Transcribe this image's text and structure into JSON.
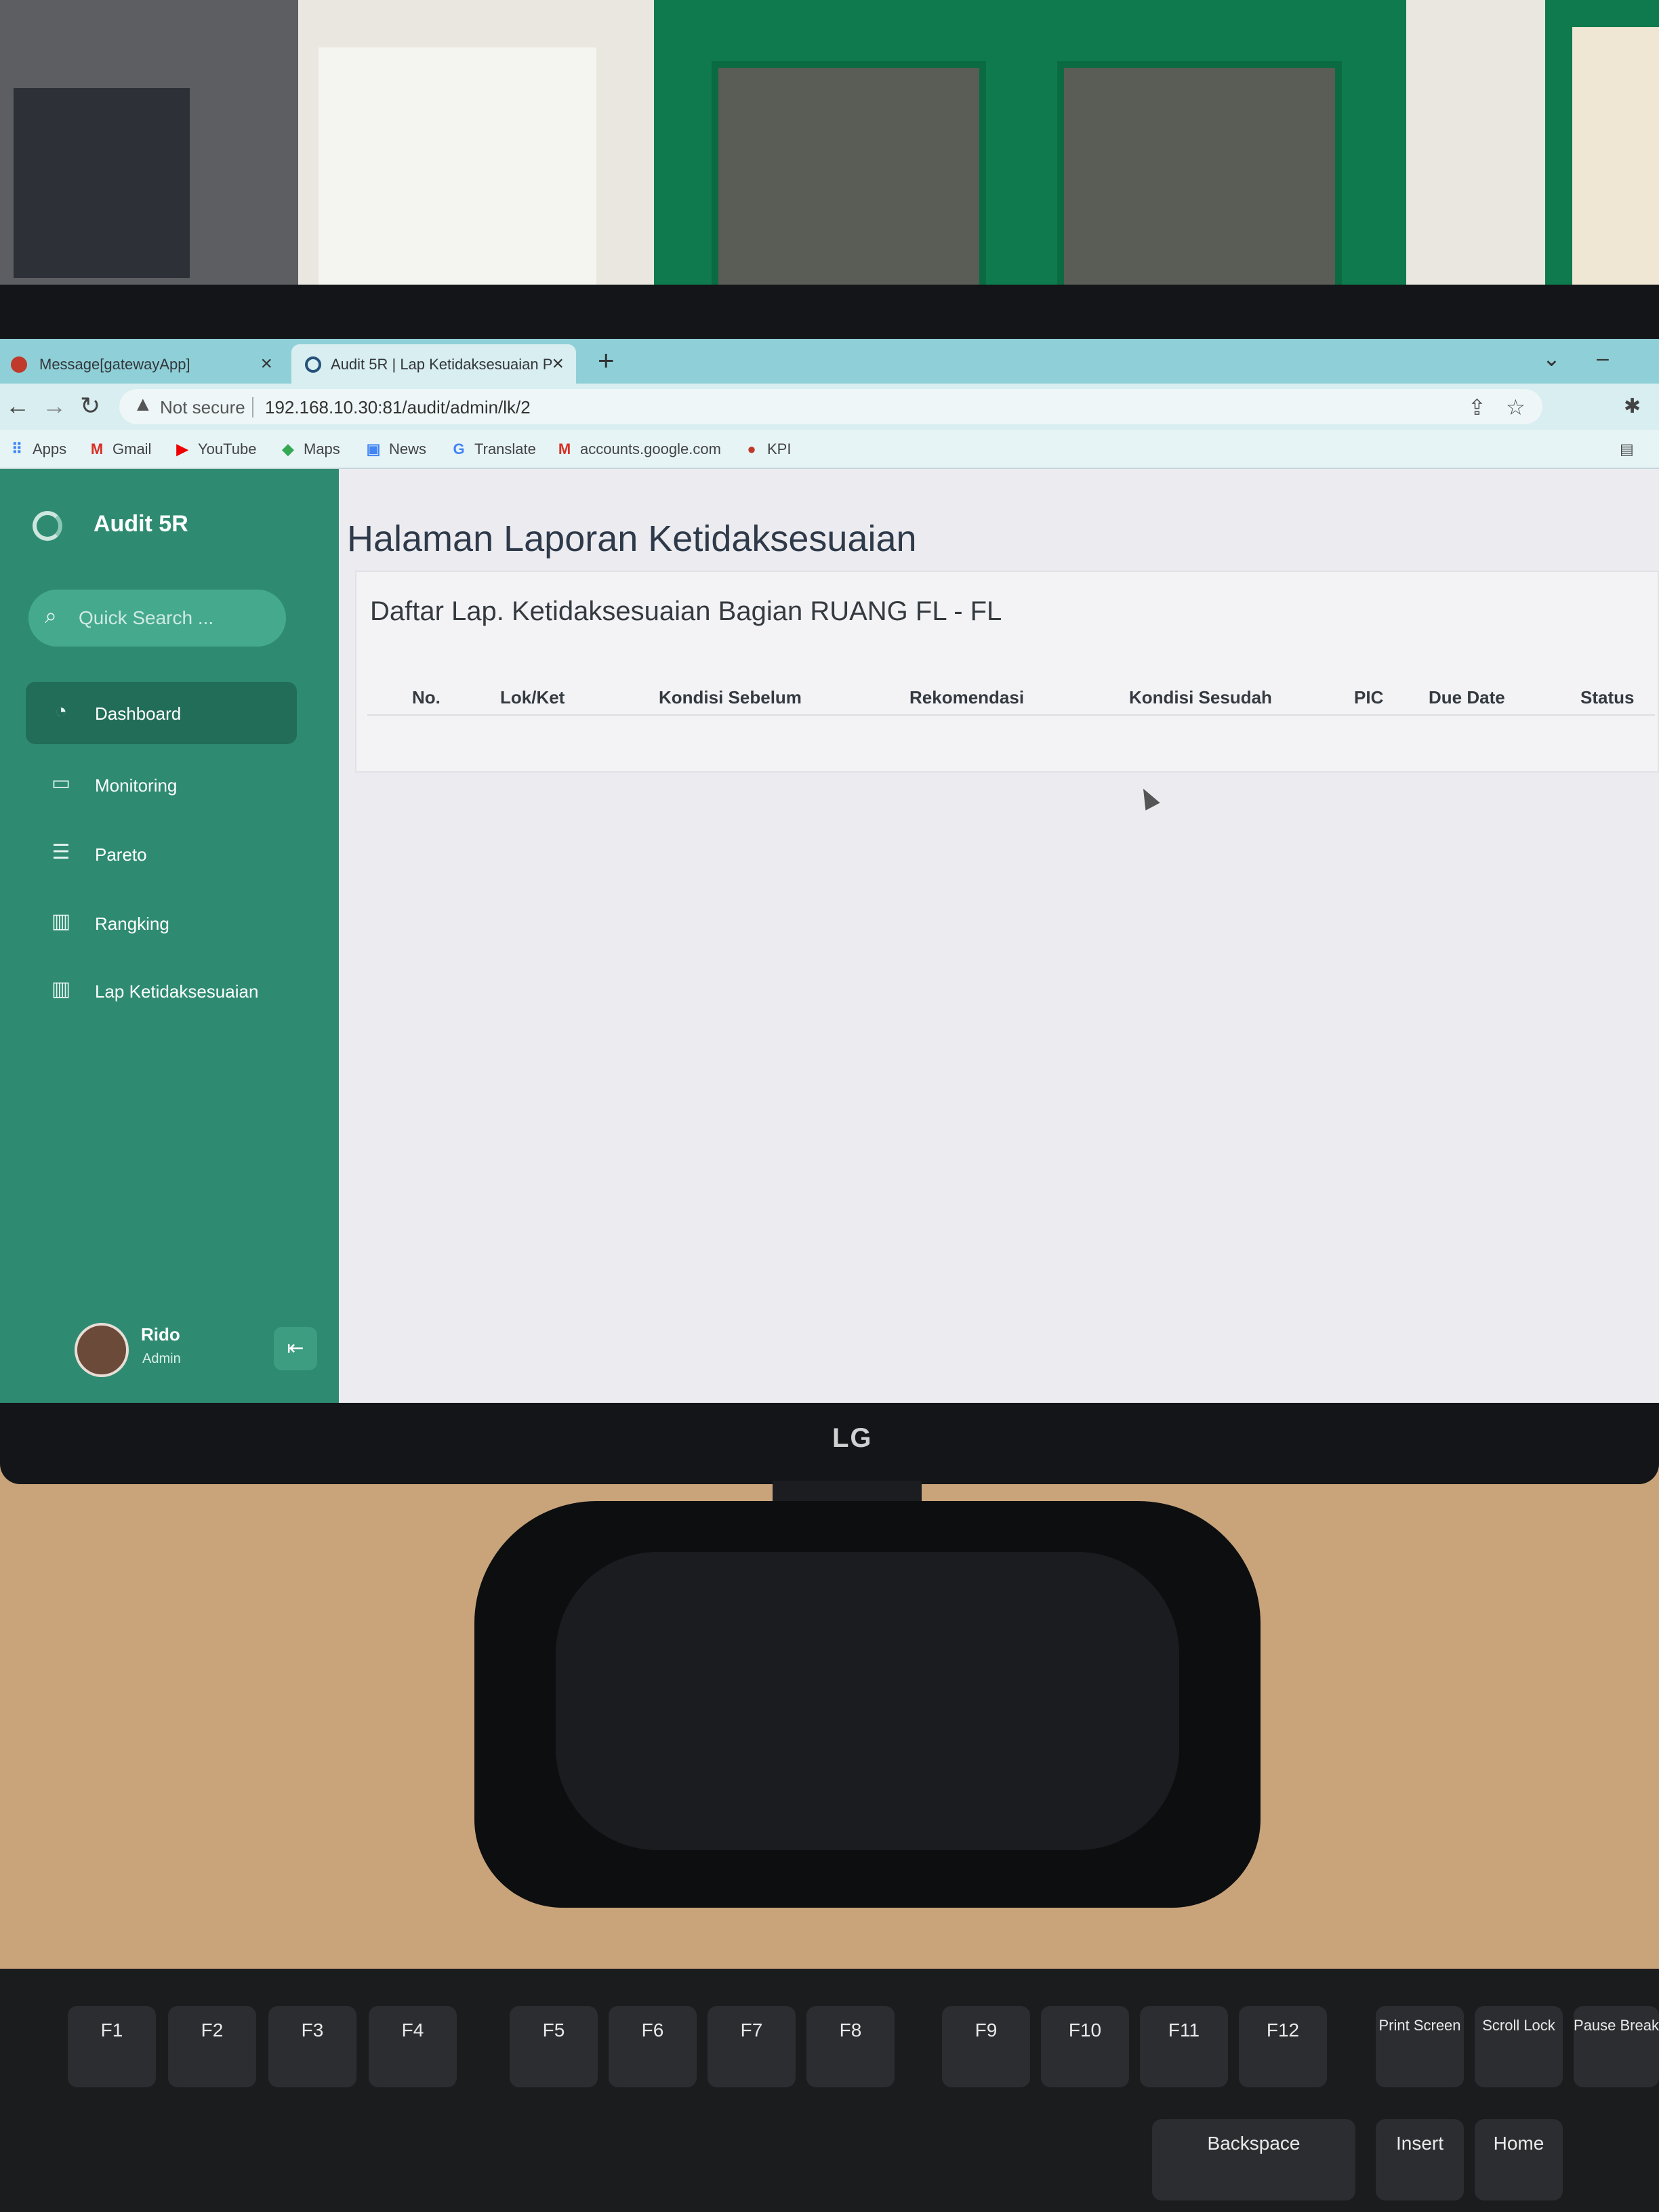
{
  "browser": {
    "tabs": [
      {
        "label": "Message[gatewayApp]"
      },
      {
        "label": "Audit 5R | Lap Ketidaksesuaian P"
      }
    ],
    "security_label": "Not secure",
    "url": "192.168.10.30:81/audit/admin/lk/2",
    "bookmarks": [
      "Apps",
      "Gmail",
      "YouTube",
      "Maps",
      "News",
      "Translate",
      "accounts.google.com",
      "KPI"
    ]
  },
  "sidebar": {
    "brand": "Audit 5R",
    "search_placeholder": "Quick Search ...",
    "items": [
      {
        "label": "Dashboard",
        "icon": "gauge-icon",
        "active": true
      },
      {
        "label": "Monitoring",
        "icon": "folder-icon"
      },
      {
        "label": "Pareto",
        "icon": "document-icon"
      },
      {
        "label": "Rangking",
        "icon": "bar-chart-icon"
      },
      {
        "label": "Lap Ketidaksesuaian",
        "icon": "bar-chart-icon"
      }
    ],
    "user": {
      "name": "Rido",
      "role": "Admin"
    }
  },
  "main": {
    "title": "Halaman Laporan Ketidaksesuaian",
    "card_title": "Daftar Lap. Ketidaksesuaian Bagian RUANG FL - FL",
    "columns": [
      "No.",
      "Lok/Ket",
      "Kondisi Sebelum",
      "Rekomendasi",
      "Kondisi Sesudah",
      "PIC",
      "Due Date",
      "Status"
    ]
  },
  "hardware": {
    "monitor_logo": "LG",
    "keys": [
      "F1",
      "F2",
      "F3",
      "F4",
      "F5",
      "F6",
      "F7",
      "F8",
      "F9",
      "F10",
      "F11",
      "F12",
      "Print Screen",
      "Scroll Lock",
      "Pause Break",
      "Backspace",
      "Insert",
      "Home"
    ]
  },
  "colors": {
    "sidebar": "#2e8b71",
    "sidebar_active": "#226d58",
    "tabbar": "#8fd0d8"
  }
}
